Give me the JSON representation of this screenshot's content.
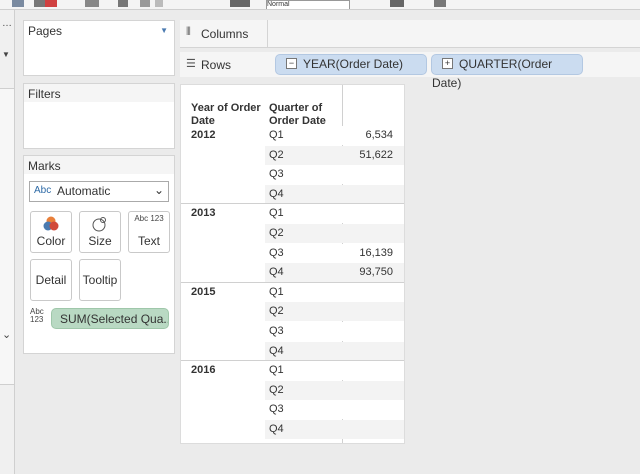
{
  "toolbar": {
    "search_value": "Normal"
  },
  "pages_card": {
    "title": "Pages"
  },
  "filters_card": {
    "title": "Filters"
  },
  "marks_card": {
    "title": "Marks",
    "mark_type_icon": "Abc",
    "mark_type": "Automatic",
    "buttons": [
      {
        "label": "Color",
        "icon": "color-icon"
      },
      {
        "label": "Size",
        "icon": "size-icon"
      },
      {
        "label": "Text",
        "icon": "text-icon",
        "icon_text": "Abc 123"
      },
      {
        "label": "Detail",
        "icon": "detail-icon"
      },
      {
        "label": "Tooltip",
        "icon": "tooltip-icon"
      }
    ],
    "pill_icon": "Abc 123",
    "pill_label": "SUM(Selected Qua..",
    "pill_color": "#b9d9c3"
  },
  "columns_shelf": {
    "label": "Columns"
  },
  "rows_shelf": {
    "label": "Rows",
    "pills": [
      {
        "label": "YEAR(Order Date)",
        "toggle": "−"
      },
      {
        "label": "QUARTER(Order Date)",
        "toggle": "+"
      }
    ],
    "pill_color": "#cbdcf0"
  },
  "table": {
    "header_year": "Year of Order Date",
    "header_quarter": "Quarter of Order Date",
    "years": [
      {
        "year": "2012",
        "rows": [
          {
            "quarter": "Q1",
            "value": "6,534"
          },
          {
            "quarter": "Q2",
            "value": "51,622"
          },
          {
            "quarter": "Q3",
            "value": ""
          },
          {
            "quarter": "Q4",
            "value": ""
          }
        ]
      },
      {
        "year": "2013",
        "rows": [
          {
            "quarter": "Q1",
            "value": ""
          },
          {
            "quarter": "Q2",
            "value": ""
          },
          {
            "quarter": "Q3",
            "value": "16,139"
          },
          {
            "quarter": "Q4",
            "value": "93,750"
          }
        ]
      },
      {
        "year": "2015",
        "rows": [
          {
            "quarter": "Q1",
            "value": ""
          },
          {
            "quarter": "Q2",
            "value": ""
          },
          {
            "quarter": "Q3",
            "value": ""
          },
          {
            "quarter": "Q4",
            "value": ""
          }
        ]
      },
      {
        "year": "2016",
        "rows": [
          {
            "quarter": "Q1",
            "value": ""
          },
          {
            "quarter": "Q2",
            "value": ""
          },
          {
            "quarter": "Q3",
            "value": ""
          },
          {
            "quarter": "Q4",
            "value": ""
          }
        ]
      }
    ]
  }
}
